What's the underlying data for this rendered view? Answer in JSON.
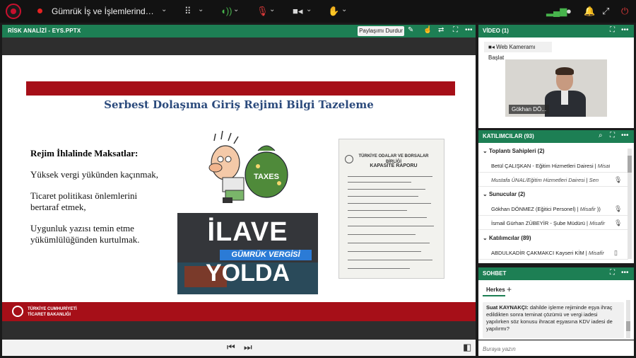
{
  "topbar": {
    "meeting_title": "Gümrük İş ve İşlemlerinde Kaçak...",
    "icons": [
      "logo-seal",
      "recording-dot",
      "chevron-down-icon",
      "grid-icon",
      "microphone-icon",
      "muted-microphone-icon",
      "camera-icon",
      "raise-hand-icon",
      "signal-icon",
      "user-icon",
      "bell-icon",
      "fullscreen-icon",
      "power-icon"
    ],
    "colors": {
      "green": "#47b34c",
      "red": "#e03a3a"
    }
  },
  "presentation": {
    "title": "RİSK ANALİZİ - EYS.PPTX",
    "stop_share_label": "Paylaşımı Durdur",
    "slide": {
      "title": "Serbest Dolaşıma Giriş Rejimi Bilgi Tazeleme",
      "subhead": "Rejim İhlalinde Maksatlar:",
      "bullets": [
        "Yüksek vergi yükünden kaçınmak,",
        "Ticaret politikası önlemlerini bertaraf etmek,",
        "Uygunluk yazısı temin etme yükümlülüğünden kurtulmak."
      ],
      "cartoon_label": "TAXES",
      "banner_line1": "İLAVE",
      "banner_line2": "GÜMRÜK VERGİSİ",
      "banner_line3": "YOLDA",
      "doc_heading": "TÜRKİYE ODALAR VE BORSALAR BİRLİĞİ",
      "doc_title": "KAPASİTE RAPORU",
      "footer_line1": "TÜRKİYE CUMHURİYETİ",
      "footer_line2": "TİCARET BAKANLIĞI",
      "colors": {
        "red_bar": "#a60f18",
        "title_blue": "#2b4a7c"
      }
    },
    "controls": [
      "previous-icon",
      "next-icon",
      "sidebar-toggle-icon"
    ]
  },
  "video": {
    "title": "VİDEO (1)",
    "webcam_button": "Web Kameramı Başlat",
    "tile_name": "Gökhan DÖ..."
  },
  "participants": {
    "title": "KATILIMCILAR",
    "count": "(93)",
    "groups": [
      {
        "label": "Toplantı Sahipleri (2)",
        "rows": [
          {
            "name": "Betül ÇALIŞKAN - Eğitim Hizmetleri Dairesi",
            "status": "Misafir"
          },
          {
            "name": "Mustafa ÜNAL/Eğitim Hizmetleri Dairesi",
            "status": "Sen"
          }
        ]
      },
      {
        "label": "Sunucular (2)",
        "rows": [
          {
            "name": "Gökhan DÖNMEZ (Eğitici Personel)",
            "status": "Misafir"
          },
          {
            "name": "İsmail Gürhan ZÜBEYİR - Şube Müdürü",
            "status": "Misafir"
          }
        ]
      },
      {
        "label": "Katılımcılar (89)",
        "rows": [
          {
            "name": "ABDULKADİR ÇAKMAKCI Kayseri KİM",
            "status": "Misafir"
          }
        ]
      }
    ]
  },
  "chat": {
    "title": "SOHBET",
    "tab_label": "Herkes",
    "message_sender": "Suat KAYNAKÇI:",
    "message_text": "dahilde işleme rejiminde eşya ihraç edildikten sonra teminat çözümü ve vergi iadesi yapılırken söz konusu ihracat eşyasına KDV iadesi de yapılırmı?",
    "input_placeholder": "Buraya yazın"
  }
}
